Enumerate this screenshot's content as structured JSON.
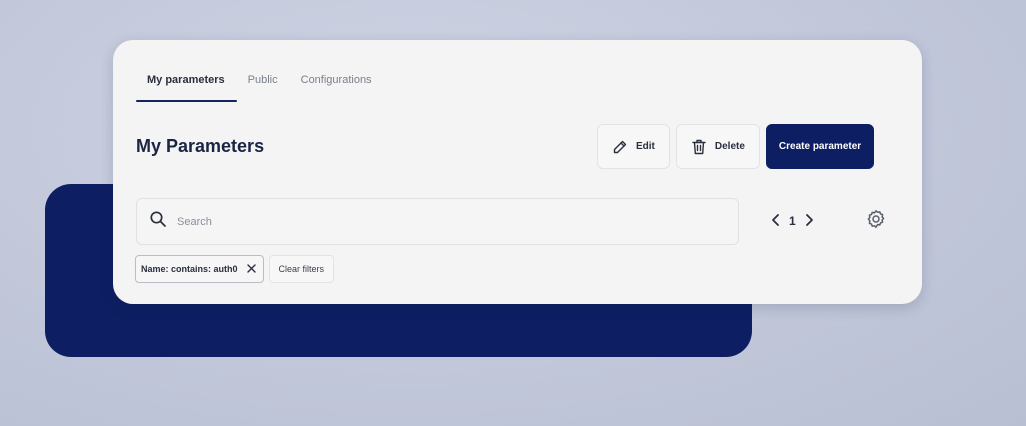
{
  "tabs": [
    {
      "label": "My parameters",
      "active": true
    },
    {
      "label": "Public",
      "active": false
    },
    {
      "label": "Configurations",
      "active": false
    }
  ],
  "page": {
    "title": "My Parameters"
  },
  "actions": {
    "edit_label": "Edit",
    "delete_label": "Delete",
    "create_label": "Create parameter"
  },
  "search": {
    "placeholder": "Search",
    "value": ""
  },
  "pagination": {
    "current_page": "1"
  },
  "filters": {
    "active_filter": "Name: contains: auth0",
    "clear_label": "Clear filters"
  },
  "icons": {
    "edit": "pencil-icon",
    "delete": "trash-icon",
    "search": "search-icon",
    "prev": "chevron-left-icon",
    "next": "chevron-right-icon",
    "settings": "gear-icon",
    "remove_filter": "close-icon"
  },
  "colors": {
    "brand": "#0d1f62",
    "background": "#c2c8da",
    "card": "#f4f4f5"
  }
}
